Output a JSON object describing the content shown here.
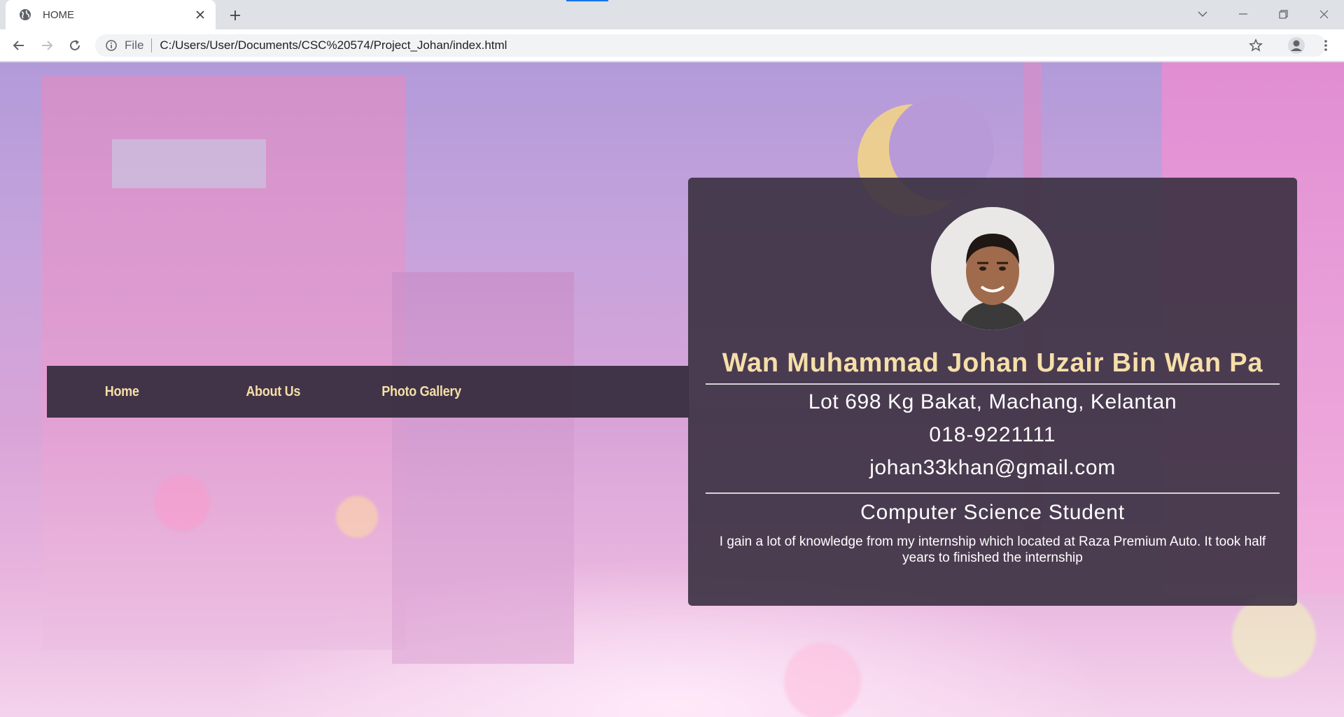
{
  "browser": {
    "tab_title": "HOME",
    "address_scheme": "File",
    "address_url": "C:/Users/User/Documents/CSC%20574/Project_Johan/index.html"
  },
  "nav": {
    "items": [
      {
        "label": "Home"
      },
      {
        "label": "About Us"
      },
      {
        "label": "Photo Gallery"
      }
    ]
  },
  "profile": {
    "name": "Wan Muhammad Johan Uzair Bin Wan Pa",
    "address": "Lot 698 Kg Bakat, Machang, Kelantan",
    "phone": "018-9221111",
    "email": "johan33khan@gmail.com",
    "role": "Computer Science Student",
    "description": "I gain a lot of knowledge from my internship which located at Raza Premium Auto. It took half years to finished the internship"
  },
  "colors": {
    "accent_text": "#f6dfa9",
    "nav_background": "#302838",
    "card_background": "#3a3040"
  }
}
